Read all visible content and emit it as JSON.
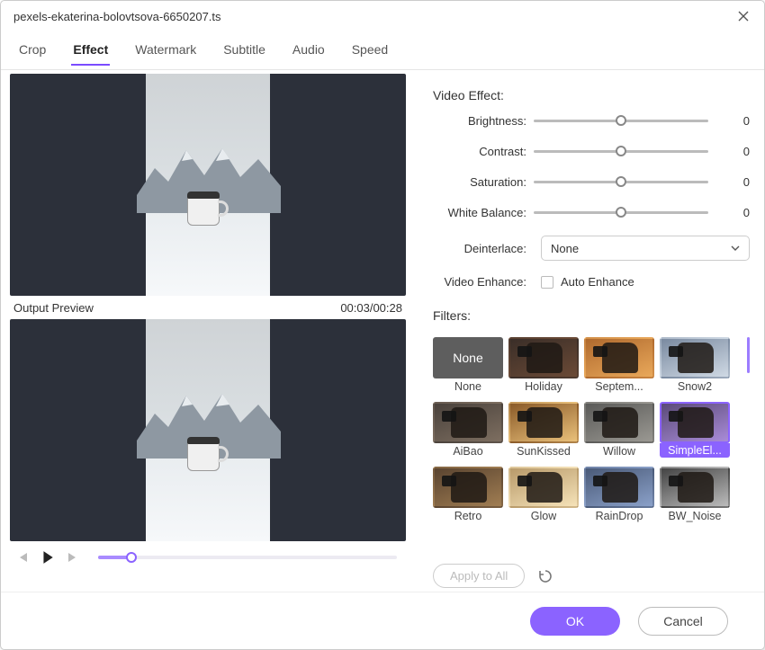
{
  "title": "pexels-ekaterina-bolovtsova-6650207.ts",
  "tabs": [
    "Crop",
    "Effect",
    "Watermark",
    "Subtitle",
    "Audio",
    "Speed"
  ],
  "active_tab_index": 1,
  "preview_label": "Output Preview",
  "timecode": "00:03/00:28",
  "progress_pct": 11,
  "section_video_effect": "Video Effect:",
  "sliders": {
    "brightness": {
      "label": "Brightness:",
      "value": 0,
      "pos": 50
    },
    "contrast": {
      "label": "Contrast:",
      "value": 0,
      "pos": 50
    },
    "saturation": {
      "label": "Saturation:",
      "value": 0,
      "pos": 50
    },
    "white_balance": {
      "label": "White Balance:",
      "value": 0,
      "pos": 50
    }
  },
  "deinterlace": {
    "label": "Deinterlace:",
    "value": "None"
  },
  "video_enhance": {
    "label": "Video Enhance:",
    "checkbox_label": "Auto Enhance",
    "checked": false
  },
  "filters_label": "Filters:",
  "filters": [
    {
      "name": "None",
      "tone": "none"
    },
    {
      "name": "Holiday",
      "tone": "warm-dark"
    },
    {
      "name": "Septem...",
      "tone": "orange"
    },
    {
      "name": "Snow2",
      "tone": "cool-snow"
    },
    {
      "name": "AiBao",
      "tone": "muted"
    },
    {
      "name": "SunKissed",
      "tone": "golden"
    },
    {
      "name": "Willow",
      "tone": "desat"
    },
    {
      "name": "SimpleEl...",
      "tone": "purple",
      "selected": true
    },
    {
      "name": "Retro",
      "tone": "sepia"
    },
    {
      "name": "Glow",
      "tone": "bright"
    },
    {
      "name": "RainDrop",
      "tone": "blue"
    },
    {
      "name": "BW_Noise",
      "tone": "bw"
    }
  ],
  "apply_all": "Apply to All",
  "buttons": {
    "ok": "OK",
    "cancel": "Cancel"
  }
}
